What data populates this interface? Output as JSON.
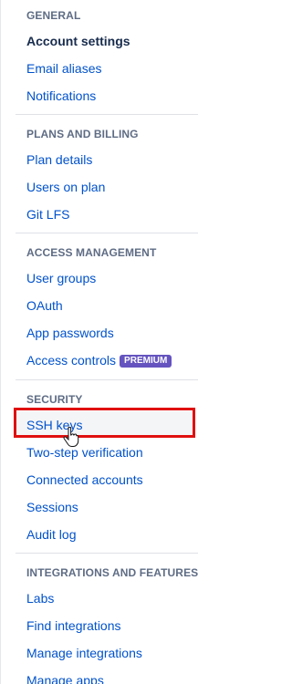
{
  "sections": {
    "general": {
      "title": "GENERAL",
      "items": [
        "Account settings",
        "Email aliases",
        "Notifications"
      ]
    },
    "plans": {
      "title": "PLANS AND BILLING",
      "items": [
        "Plan details",
        "Users on plan",
        "Git LFS"
      ]
    },
    "access": {
      "title": "ACCESS MANAGEMENT",
      "items": [
        "User groups",
        "OAuth",
        "App passwords",
        "Access controls"
      ],
      "badge": "PREMIUM"
    },
    "security": {
      "title": "SECURITY",
      "items": [
        "SSH keys",
        "Two-step verification",
        "Connected accounts",
        "Sessions",
        "Audit log"
      ]
    },
    "integrations": {
      "title": "INTEGRATIONS AND FEATURES",
      "items": [
        "Labs",
        "Find integrations",
        "Manage integrations",
        "Manage apps"
      ]
    }
  },
  "colors": {
    "link": "#0052cc",
    "heading": "#5e6c84",
    "selected": "#172b4d",
    "badge": "#6554c0",
    "highlight": "#e01010"
  },
  "cursor_icon": "hand-pointer-icon"
}
